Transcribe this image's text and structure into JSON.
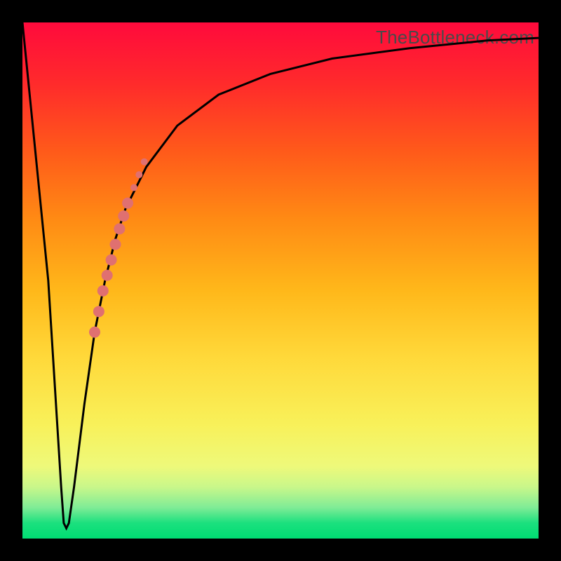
{
  "watermark": "TheBottleneck.com",
  "chart_data": {
    "type": "line",
    "title": "",
    "xlabel": "",
    "ylabel": "",
    "xlim": [
      0,
      100
    ],
    "ylim": [
      0,
      100
    ],
    "series": [
      {
        "name": "bottleneck-curve",
        "x": [
          0,
          5,
          7.5,
          8,
          8.5,
          9,
          10,
          12,
          14,
          16,
          18,
          20,
          24,
          30,
          38,
          48,
          60,
          75,
          90,
          100
        ],
        "y": [
          100,
          50,
          10,
          3,
          2,
          3,
          10,
          26,
          40,
          50,
          58,
          64,
          72,
          80,
          86,
          90,
          93,
          95,
          96.5,
          97
        ]
      }
    ],
    "highlight_segment": {
      "name": "overlay-marks",
      "points": [
        {
          "x": 14.0,
          "y": 40.0,
          "r": 8
        },
        {
          "x": 14.8,
          "y": 44.0,
          "r": 8
        },
        {
          "x": 15.6,
          "y": 48.0,
          "r": 8
        },
        {
          "x": 16.4,
          "y": 51.0,
          "r": 8
        },
        {
          "x": 17.2,
          "y": 54.0,
          "r": 8
        },
        {
          "x": 18.0,
          "y": 57.0,
          "r": 8
        },
        {
          "x": 18.8,
          "y": 60.0,
          "r": 8
        },
        {
          "x": 19.6,
          "y": 62.5,
          "r": 8
        },
        {
          "x": 20.4,
          "y": 65.0,
          "r": 8
        },
        {
          "x": 21.6,
          "y": 68.0,
          "r": 5
        },
        {
          "x": 22.6,
          "y": 70.5,
          "r": 5
        },
        {
          "x": 23.6,
          "y": 73.0,
          "r": 5
        }
      ]
    },
    "colors": {
      "curve": "#000000",
      "highlight": "#e07070",
      "gradient_top": "#ff0a3c",
      "gradient_bottom": "#00dd73"
    }
  }
}
